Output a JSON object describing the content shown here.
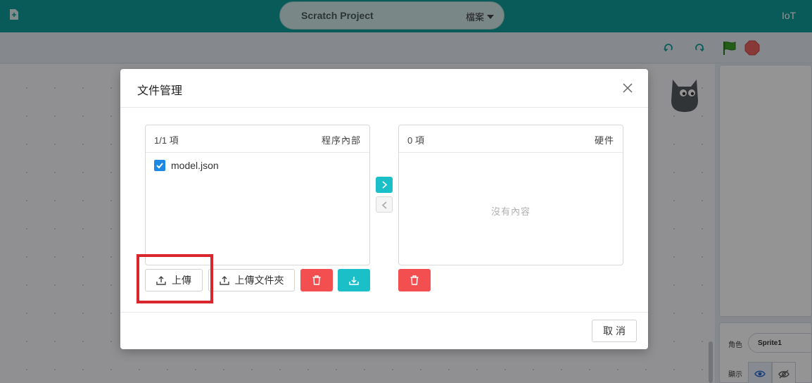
{
  "header": {
    "project_title": "Scratch Project",
    "file_menu_label": "檔案",
    "right_label": "IoT",
    "bar_color": "#0f9e9a"
  },
  "sprite_panel": {
    "sprite_label": "角色",
    "sprite_name": "Sprite1",
    "show_label": "顯示"
  },
  "dialog": {
    "title": "文件管理",
    "left_panel": {
      "count": "1/1 項",
      "name": "程序內部",
      "items": [
        {
          "label": "model.json",
          "checked": true
        }
      ]
    },
    "right_panel": {
      "count": "0 項",
      "name": "硬件",
      "empty_text": "沒有內容"
    },
    "buttons": {
      "upload": "上傳",
      "upload_folder": "上傳文件夾",
      "cancel": "取消"
    },
    "colors": {
      "danger": "#f34f51",
      "primary": "#1bbfc7",
      "checkbox": "#1e88e5",
      "highlight": "#d9262c"
    }
  }
}
